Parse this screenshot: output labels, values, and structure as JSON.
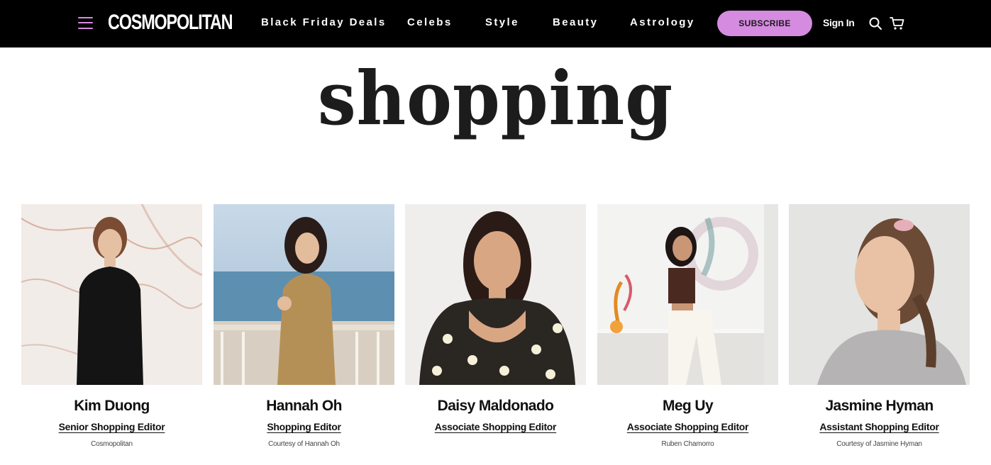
{
  "header": {
    "logo": "COSMOPOLITAN",
    "nav": [
      "Black Friday Deals",
      "Celebs",
      "Style",
      "Beauty",
      "Astrology"
    ],
    "subscribe_label": "SUBSCRIBE",
    "signin_label": "Sign In",
    "icons": [
      "menu-icon",
      "search-icon",
      "cart-icon"
    ],
    "accent": "#d58be0"
  },
  "page": {
    "title": "shopping"
  },
  "editors": [
    {
      "name": "Kim Duong",
      "role": "Senior Shopping Editor",
      "credit": "Cosmopolitan"
    },
    {
      "name": "Hannah Oh",
      "role": "Shopping Editor",
      "credit": "Courtesy of Hannah Oh"
    },
    {
      "name": "Daisy Maldonado",
      "role": "Associate Shopping Editor",
      "credit": ""
    },
    {
      "name": "Meg Uy",
      "role": "Associate Shopping Editor",
      "credit": "Ruben Chamorro"
    },
    {
      "name": "Jasmine Hyman",
      "role": "Assistant Shopping Editor",
      "credit": "Courtesy of Jasmine Hyman"
    }
  ]
}
